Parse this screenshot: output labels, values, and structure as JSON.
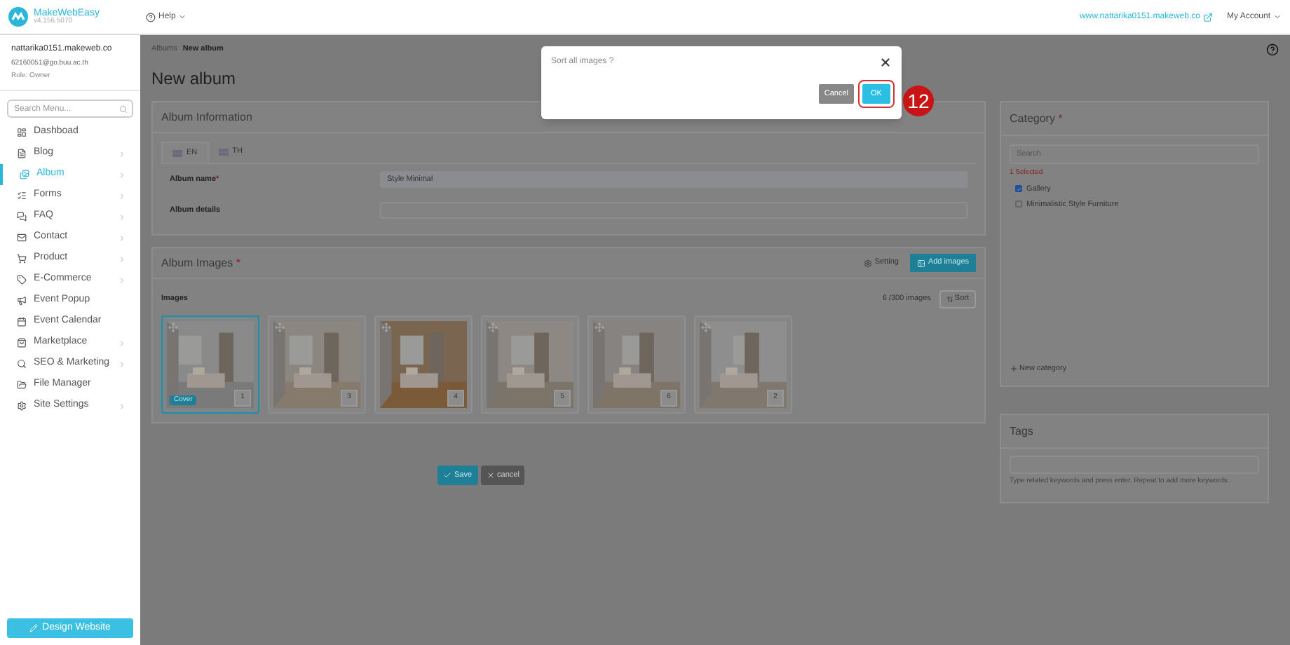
{
  "header": {
    "logo_name": "MakeWebEasy",
    "version": "v4.156.5070",
    "help": "Help",
    "site_link": "www.nattarika0151.makeweb.co",
    "account": "My Account"
  },
  "user": {
    "name": "nattarika0151.makeweb.co",
    "email": "62160051@go.buu.ac.th",
    "role": "Role: Owner"
  },
  "sidebar": {
    "search": {
      "placeholder": "Search Menu..."
    },
    "items": [
      {
        "label": "Dashboad",
        "selected": false,
        "has_submenu": false
      },
      {
        "label": "Blog",
        "selected": false,
        "has_submenu": true
      },
      {
        "label": "Album",
        "selected": true,
        "has_submenu": true
      },
      {
        "label": "Forms",
        "selected": false,
        "has_submenu": true
      },
      {
        "label": "FAQ",
        "selected": false,
        "has_submenu": true
      },
      {
        "label": "Contact",
        "selected": false,
        "has_submenu": true
      },
      {
        "label": "Product",
        "selected": false,
        "has_submenu": true
      },
      {
        "label": "E-Commerce",
        "selected": false,
        "has_submenu": true
      },
      {
        "label": "Event Popup",
        "selected": false,
        "has_submenu": false
      },
      {
        "label": "Event Calendar",
        "selected": false,
        "has_submenu": false
      },
      {
        "label": "Marketplace",
        "selected": false,
        "has_submenu": true
      },
      {
        "label": "SEO & Marketing",
        "selected": false,
        "has_submenu": true
      },
      {
        "label": "File Manager",
        "selected": false,
        "has_submenu": false
      },
      {
        "label": "Site Settings",
        "selected": false,
        "has_submenu": true
      }
    ],
    "design_button": "Design Website"
  },
  "breadcrumb": [
    "Albums",
    "New album"
  ],
  "page_title": "New album",
  "album_info": {
    "title": "Album Information",
    "tabs": [
      {
        "label": "EN",
        "selected": true
      },
      {
        "label": "TH",
        "selected": false
      }
    ],
    "fields": [
      {
        "label": "Album name",
        "required_mark": "*",
        "value": "Style Minimal"
      },
      {
        "label": "Album details"
      }
    ]
  },
  "album_images": {
    "title": "Album Images",
    "required_mark": "*",
    "setting": "Setting",
    "add_button": "Add images",
    "images_label": "Images",
    "count": "6 /300 images",
    "sort": "Sort",
    "images": [
      {
        "number": "1",
        "cover": "Cover",
        "selected": true
      },
      {
        "number": "3",
        "selected": false
      },
      {
        "number": "4",
        "selected": false
      },
      {
        "number": "5",
        "selected": false
      },
      {
        "number": "6",
        "selected": false
      },
      {
        "number": "2",
        "selected": false
      }
    ]
  },
  "actions": {
    "save": "Save",
    "cancel": "cancel"
  },
  "category": {
    "title": "Category",
    "required_mark": "*",
    "search": {
      "placeholder": "Search"
    },
    "selected_count": "1 Selected",
    "items": [
      {
        "label": "Gallery",
        "checked": true
      },
      {
        "label": "Minimalistic Style Furniture",
        "checked": false
      }
    ],
    "new_category": "New category"
  },
  "tags": {
    "title": "Tags",
    "hint": "Type related keywords and press enter. Repeat to add more keywords."
  },
  "dialog": {
    "message": "Sort all images ?",
    "cancel": "Cancel",
    "ok": "OK",
    "step_badge": "12"
  }
}
